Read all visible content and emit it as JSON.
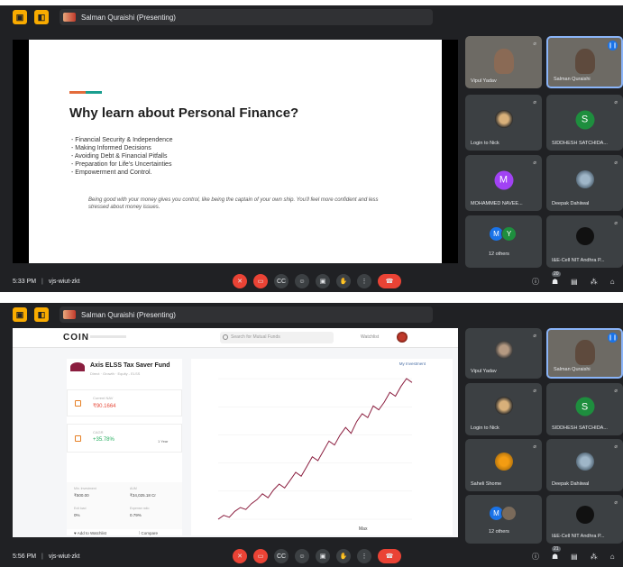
{
  "screens": [
    {
      "presenter_label": "Salman Quraishi (Presenting)",
      "slide": {
        "title": "Why learn about Personal Finance?",
        "bullets": [
          "Financial Security & Independence",
          "Making Informed Decisions",
          "Avoiding Debt & Financial Pitfalls",
          "Preparation for Life's Uncertainties",
          "Empowerment and Control."
        ],
        "note": "Being good with your money gives you control, like being the captain of your own ship. You'll feel more confident and less stressed about money issues."
      },
      "tiles": [
        {
          "name": "Vipul Yadav"
        },
        {
          "name": "Salman Quraishi"
        },
        {
          "name": "Login to Nick"
        },
        {
          "name": "SIDDHESH SATCHIDA...",
          "letter": "S"
        },
        {
          "name": "MOHAMMED NAVEE...",
          "letter": "M"
        },
        {
          "name": "Deepak Dahiiwal"
        },
        {
          "name": "12 others",
          "letters": [
            "M",
            "Y"
          ]
        },
        {
          "name": "I&E-Cell NIT Andhra P..."
        }
      ],
      "clock": "5:33 PM",
      "meeting_code": "vjs-wiut-zkt",
      "participant_count": "20"
    },
    {
      "presenter_label": "Salman Quraishi (Presenting)",
      "web": {
        "brand": "COIN",
        "search_placeholder": "Search for Mutual Funds",
        "watchlist": "Watchlist",
        "fund_name": "Axis ELSS Tax Saver Fund",
        "fund_meta": "Direct · Growth · Equity - ELSS",
        "my_investment": "My Investment",
        "current_nav_label": "Current NAV",
        "current_nav": "₹90.1664",
        "cagr_label": "CAGR",
        "cagr": "+35.78%",
        "cagr_period": "1 Year",
        "min_investment_label": "Min. Investment",
        "min_investment": "₹500.00",
        "aum_label": "AUM",
        "aum": "₹34,025.18 Cr",
        "exit_load_label": "Exit load",
        "exit_load": "0%",
        "expense_ratio_label": "Expense ratio",
        "expense_ratio": "0.79%",
        "add_watchlist": "Add to Watchlist",
        "compare": "Compare",
        "range_label": "Max"
      },
      "tiles": [
        {
          "name": "Vipul Yadav"
        },
        {
          "name": "Salman Quraishi"
        },
        {
          "name": "Login to Nick"
        },
        {
          "name": "SIDDHESH SATCHIDA...",
          "letter": "S"
        },
        {
          "name": "Saheli Shome"
        },
        {
          "name": "Deepak Dahiiwal"
        },
        {
          "name": "12 others",
          "letters": [
            "M"
          ]
        },
        {
          "name": "I&E-Cell NIT Andhra P..."
        }
      ],
      "clock": "5:56 PM",
      "meeting_code": "vjs-wiut-zkt",
      "participant_count": "21"
    }
  ],
  "separator": "|",
  "colors": {
    "meet_bg": "#202124",
    "tile_bg": "#3c4043",
    "accent_yellow": "#f9ab00",
    "end_call_red": "#ea4335",
    "avatar_green": "#1e8e3e",
    "avatar_purple": "#a142f4",
    "chart_line": "#8b1e3f"
  },
  "chart_data": {
    "type": "line",
    "title": "",
    "xlabel": "",
    "ylabel": "",
    "series": [
      {
        "values": [
          20,
          22,
          21,
          24,
          26,
          25,
          28,
          30,
          33,
          31,
          35,
          38,
          36,
          40,
          44,
          42,
          47,
          52,
          50,
          55,
          60,
          58,
          63,
          67,
          64,
          70,
          74,
          72,
          78,
          76,
          80,
          85,
          83,
          88,
          92,
          90
        ]
      }
    ]
  },
  "icons": [
    "mic-off-icon",
    "camera-off-icon",
    "captions-icon",
    "emoji-icon",
    "present-icon",
    "raise-hand-icon",
    "more-icon",
    "end-call-icon",
    "info-icon",
    "people-icon",
    "chat-icon",
    "activities-icon",
    "lock-icon"
  ]
}
